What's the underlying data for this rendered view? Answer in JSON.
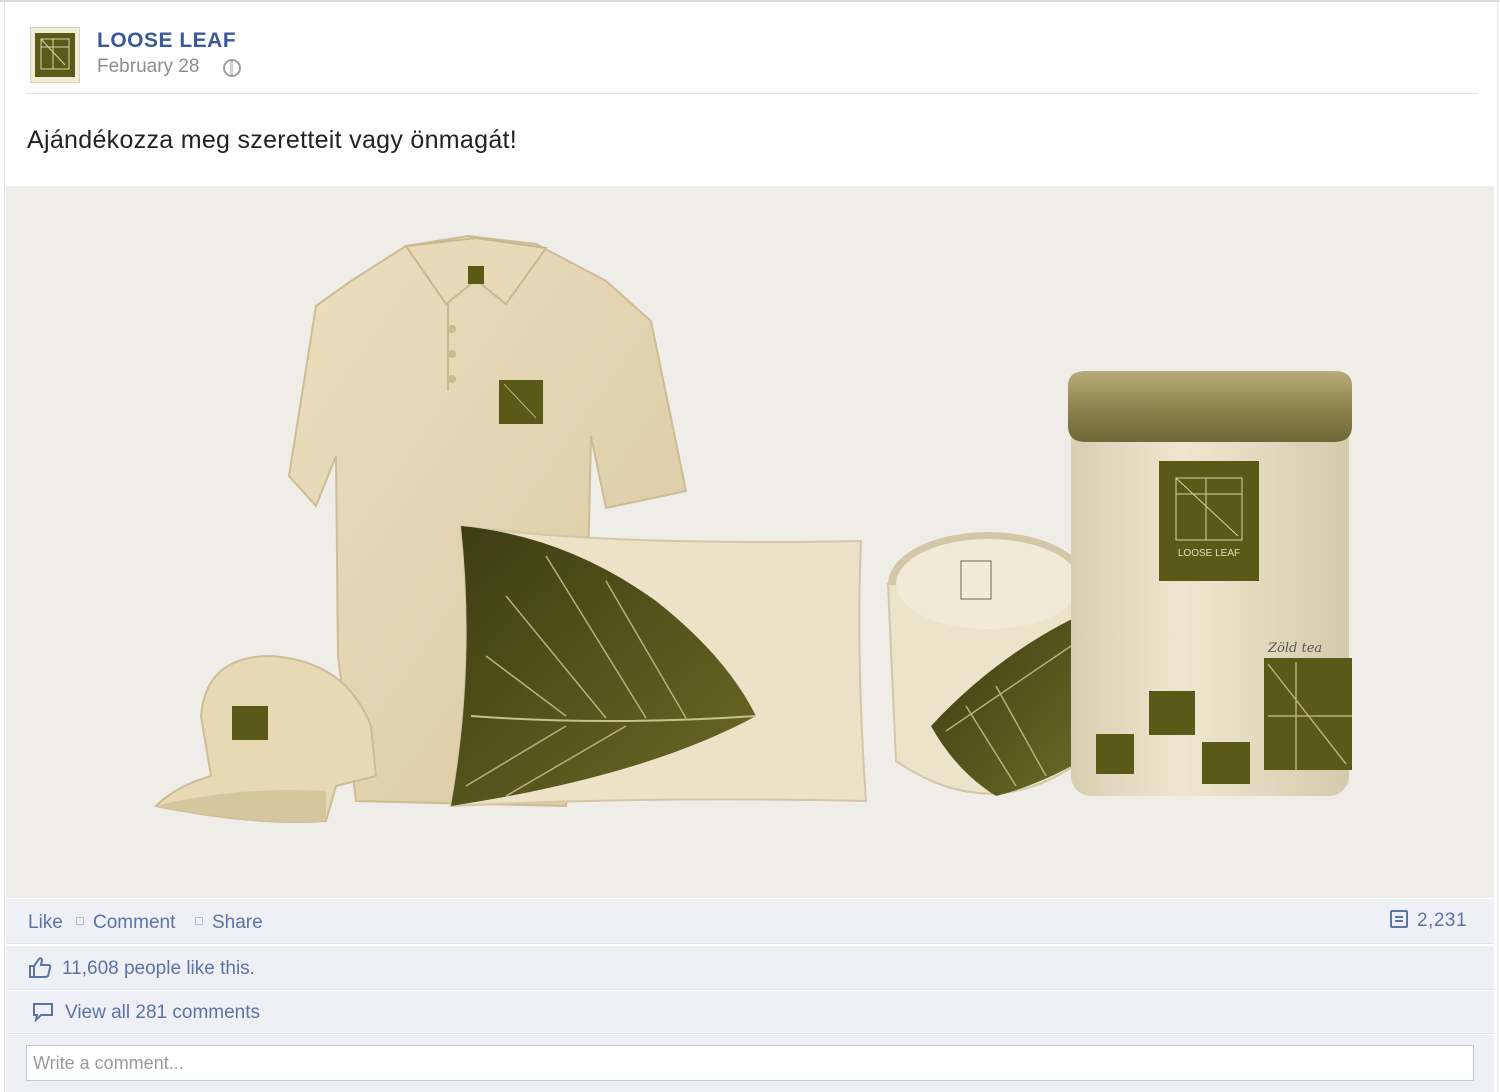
{
  "post": {
    "page_name": "LOOSE LEAF",
    "date": "February 28",
    "privacy_icon": "globe-icon",
    "text": "Ajándékozza meg szeretteit vagy önmagát!"
  },
  "photo": {
    "tin_logo_text": "LOOSE LEAF",
    "tin_script_text": "Zöld tea"
  },
  "actions": {
    "like": "Like",
    "comment": "Comment",
    "share": "Share",
    "share_count": "2,231"
  },
  "likes": {
    "text": "11,608 people like this."
  },
  "comments": {
    "view_all": "View all 281 comments"
  },
  "comment_box": {
    "placeholder": "Write a comment..."
  },
  "colors": {
    "brand_olive": "#5a5a18",
    "link_blue": "#3b5998",
    "action_blue": "#5b74a8",
    "cream": "#e9dcbb"
  }
}
